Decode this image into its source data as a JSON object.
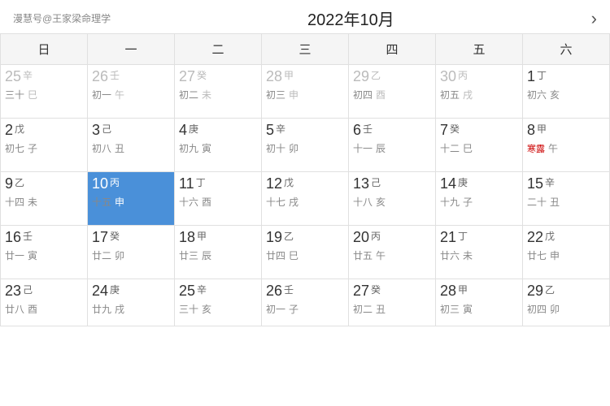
{
  "header": {
    "watermark": "漫慧号@王家梁命理学",
    "title": "2022年10月",
    "arrow": "›"
  },
  "weekdays": [
    "日",
    "一",
    "二",
    "三",
    "四",
    "五",
    "六"
  ],
  "weeks": [
    [
      {
        "date": "25",
        "gz": "辛",
        "lunar": "三十",
        "gz2": "巳",
        "otherMonth": true
      },
      {
        "date": "26",
        "gz": "壬",
        "lunar": "初一",
        "gz2": "午",
        "otherMonth": true
      },
      {
        "date": "27",
        "gz": "癸",
        "lunar": "初二",
        "gz2": "未",
        "otherMonth": true
      },
      {
        "date": "28",
        "gz": "甲",
        "lunar": "初三",
        "gz2": "申",
        "otherMonth": true
      },
      {
        "date": "29",
        "gz": "乙",
        "lunar": "初四",
        "gz2": "酉",
        "otherMonth": true
      },
      {
        "date": "30",
        "gz": "丙",
        "lunar": "初五",
        "gz2": "戌",
        "otherMonth": true
      },
      {
        "date": "1",
        "gz": "丁",
        "lunar": "初六",
        "gz2": "亥",
        "otherMonth": false,
        "solarTerm": ""
      }
    ],
    [
      {
        "date": "2",
        "gz": "戊",
        "lunar": "初七",
        "gz2": "子",
        "otherMonth": false
      },
      {
        "date": "3",
        "gz": "己",
        "lunar": "初八",
        "gz2": "丑",
        "otherMonth": false
      },
      {
        "date": "4",
        "gz": "庚",
        "lunar": "初九",
        "gz2": "寅",
        "otherMonth": false
      },
      {
        "date": "5",
        "gz": "辛",
        "lunar": "初十",
        "gz2": "卯",
        "otherMonth": false
      },
      {
        "date": "6",
        "gz": "壬",
        "lunar": "十一",
        "gz2": "辰",
        "otherMonth": false
      },
      {
        "date": "7",
        "gz": "癸",
        "lunar": "十二",
        "gz2": "巳",
        "otherMonth": false
      },
      {
        "date": "8",
        "gz": "甲",
        "lunar": "寒露",
        "gz2": "午",
        "otherMonth": false,
        "solarTerm": "寒露"
      }
    ],
    [
      {
        "date": "9",
        "gz": "乙",
        "lunar": "十四",
        "gz2": "未",
        "otherMonth": false
      },
      {
        "date": "10",
        "gz": "丙",
        "lunar": "十五",
        "gz2": "申",
        "otherMonth": false,
        "today": true
      },
      {
        "date": "11",
        "gz": "丁",
        "lunar": "十六",
        "gz2": "酉",
        "otherMonth": false
      },
      {
        "date": "12",
        "gz": "戊",
        "lunar": "十七",
        "gz2": "戌",
        "otherMonth": false
      },
      {
        "date": "13",
        "gz": "己",
        "lunar": "十八",
        "gz2": "亥",
        "otherMonth": false
      },
      {
        "date": "14",
        "gz": "庚",
        "lunar": "十九",
        "gz2": "子",
        "otherMonth": false
      },
      {
        "date": "15",
        "gz": "辛",
        "lunar": "二十",
        "gz2": "丑",
        "otherMonth": false
      }
    ],
    [
      {
        "date": "16",
        "gz": "壬",
        "lunar": "廿一",
        "gz2": "寅",
        "otherMonth": false
      },
      {
        "date": "17",
        "gz": "癸",
        "lunar": "廿二",
        "gz2": "卯",
        "otherMonth": false
      },
      {
        "date": "18",
        "gz": "甲",
        "lunar": "廿三",
        "gz2": "辰",
        "otherMonth": false
      },
      {
        "date": "19",
        "gz": "乙",
        "lunar": "廿四",
        "gz2": "巳",
        "otherMonth": false
      },
      {
        "date": "20",
        "gz": "丙",
        "lunar": "廿五",
        "gz2": "午",
        "otherMonth": false
      },
      {
        "date": "21",
        "gz": "丁",
        "lunar": "廿六",
        "gz2": "未",
        "otherMonth": false
      },
      {
        "date": "22",
        "gz": "戊",
        "lunar": "廿七",
        "gz2": "申",
        "otherMonth": false
      }
    ],
    [
      {
        "date": "23",
        "gz": "己",
        "lunar": "廿八",
        "gz2": "酉",
        "otherMonth": false
      },
      {
        "date": "24",
        "gz": "庚",
        "lunar": "廿九",
        "gz2": "戌",
        "otherMonth": false
      },
      {
        "date": "25",
        "gz": "辛",
        "lunar": "三十",
        "gz2": "亥",
        "otherMonth": false
      },
      {
        "date": "26",
        "gz": "壬",
        "lunar": "初一",
        "gz2": "子",
        "otherMonth": false
      },
      {
        "date": "27",
        "gz": "癸",
        "lunar": "初二",
        "gz2": "丑",
        "otherMonth": false
      },
      {
        "date": "28",
        "gz": "甲",
        "lunar": "初三",
        "gz2": "寅",
        "otherMonth": false
      },
      {
        "date": "29",
        "gz": "乙",
        "lunar": "初四",
        "gz2": "卯",
        "otherMonth": false
      }
    ]
  ]
}
